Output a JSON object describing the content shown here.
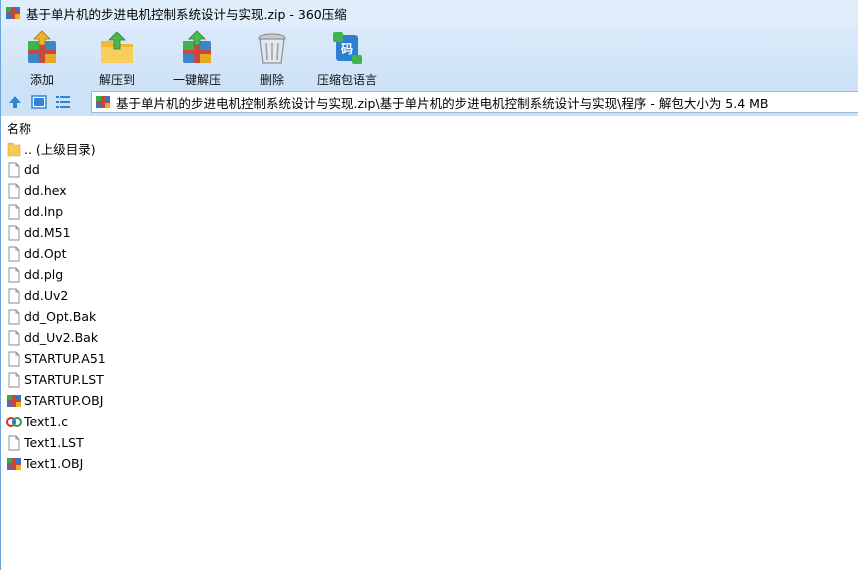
{
  "window": {
    "title": "基于单片机的步进电机控制系统设计与实现.zip - 360压缩"
  },
  "toolbar": {
    "add_label": "添加",
    "extract_to_label": "解压到",
    "one_click_extract_label": "一键解压",
    "delete_label": "删除",
    "codepage_label": "压缩包语言"
  },
  "address": {
    "path": "基于单片机的步进电机控制系统设计与实现.zip\\基于单片机的步进电机控制系统设计与实现\\程序 - 解包大小为 5.4 MB"
  },
  "list": {
    "header": "名称",
    "items": [
      {
        "name": ".. (上级目录)",
        "icon": "folder-icon"
      },
      {
        "name": "dd",
        "icon": "file-icon"
      },
      {
        "name": "dd.hex",
        "icon": "file-icon"
      },
      {
        "name": "dd.lnp",
        "icon": "file-icon"
      },
      {
        "name": "dd.M51",
        "icon": "file-icon"
      },
      {
        "name": "dd.Opt",
        "icon": "file-icon"
      },
      {
        "name": "dd.plg",
        "icon": "file-icon"
      },
      {
        "name": "dd.Uv2",
        "icon": "file-icon"
      },
      {
        "name": "dd_Opt.Bak",
        "icon": "file-icon"
      },
      {
        "name": "dd_Uv2.Bak",
        "icon": "file-icon"
      },
      {
        "name": "STARTUP.A51",
        "icon": "file-icon"
      },
      {
        "name": "STARTUP.LST",
        "icon": "file-icon"
      },
      {
        "name": "STARTUP.OBJ",
        "icon": "archive-icon"
      },
      {
        "name": "Text1.c",
        "icon": "c-source-icon"
      },
      {
        "name": "Text1.LST",
        "icon": "file-icon"
      },
      {
        "name": "Text1.OBJ",
        "icon": "archive-icon"
      }
    ]
  }
}
